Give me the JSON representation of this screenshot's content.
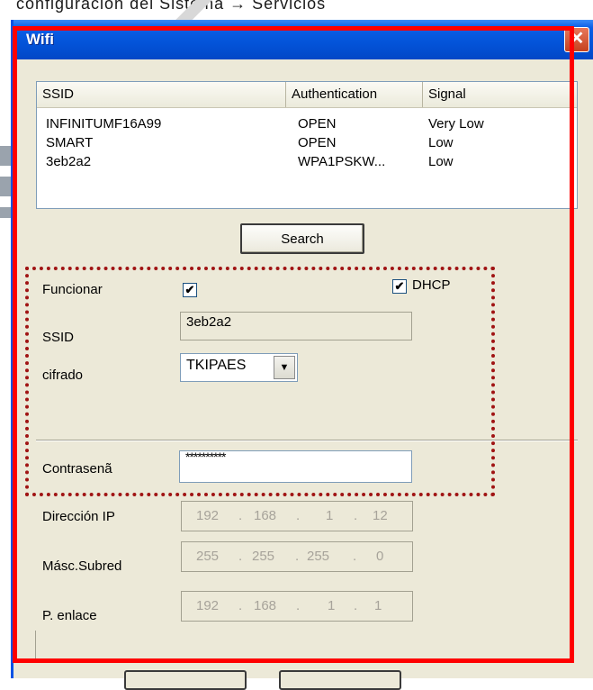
{
  "window": {
    "title": "Wifi",
    "close_glyph": "✕"
  },
  "network_list": {
    "headers": {
      "ssid": "SSID",
      "authentication": "Authentication",
      "signal": "Signal"
    },
    "rows": [
      {
        "ssid": "INFINITUMF16A99",
        "auth": "OPEN",
        "signal": "Very Low"
      },
      {
        "ssid": "SMART",
        "auth": "OPEN",
        "signal": "Low"
      },
      {
        "ssid": "3eb2a2",
        "auth": "WPA1PSKW...",
        "signal": "Low"
      }
    ]
  },
  "search_button": "Search",
  "form": {
    "funcionar_label": "Funcionar",
    "funcionar_checked": true,
    "dhcp_label": "DHCP",
    "dhcp_checked": true,
    "ssid_label": "SSID",
    "ssid_value": "3eb2a2",
    "cifrado_label": "cifrado",
    "cifrado_value": "TKIPAES",
    "password_label": "Contrasenã",
    "password_value": "**********",
    "ip_label": "Dirección IP",
    "ip": [
      "192",
      "168",
      "1",
      "12"
    ],
    "mask_label": "Másc.Subred",
    "mask": [
      "255",
      "255",
      "255",
      "0"
    ],
    "gateway_label": "P. enlace",
    "gateway": [
      "192",
      "168",
      "1",
      "1"
    ]
  },
  "icons": {
    "check": "✔",
    "dropdown": "▼"
  },
  "colors": {
    "titlebar": "#0353d8",
    "highlight_red": "#ff0000",
    "dotted": "#a01414"
  }
}
